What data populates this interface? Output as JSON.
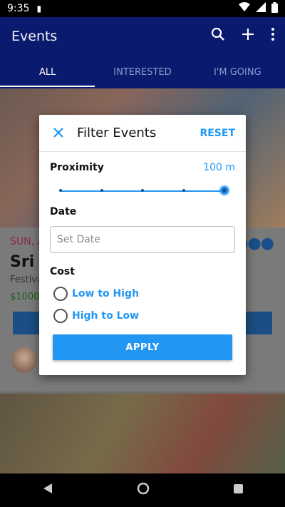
{
  "status_bar": {
    "time": "9:35"
  },
  "app_bar": {
    "title": "Events",
    "tabs": [
      {
        "label": "ALL"
      },
      {
        "label": "INTERESTED"
      },
      {
        "label": "I'M GOING"
      }
    ]
  },
  "background_card": {
    "date": "SUN, A",
    "name": "Sri K",
    "category": "Festiva",
    "price": "$1000"
  },
  "dialog": {
    "title": "Filter Events",
    "reset_label": "RESET",
    "proximity": {
      "label": "Proximity",
      "value_text": "100 m",
      "level": 1.0
    },
    "date": {
      "label": "Date",
      "placeholder": "Set Date",
      "value": ""
    },
    "cost": {
      "label": "Cost",
      "options": [
        {
          "label": "Low to High",
          "selected": false
        },
        {
          "label": "High to Low",
          "selected": false
        }
      ]
    },
    "apply_label": "APPLY"
  },
  "colors": {
    "accent": "#2196f3",
    "appbar": "#0a1a6e"
  },
  "icons": {
    "close": "close-icon",
    "search": "search-icon",
    "add": "add-icon",
    "more": "more-vert-icon"
  }
}
